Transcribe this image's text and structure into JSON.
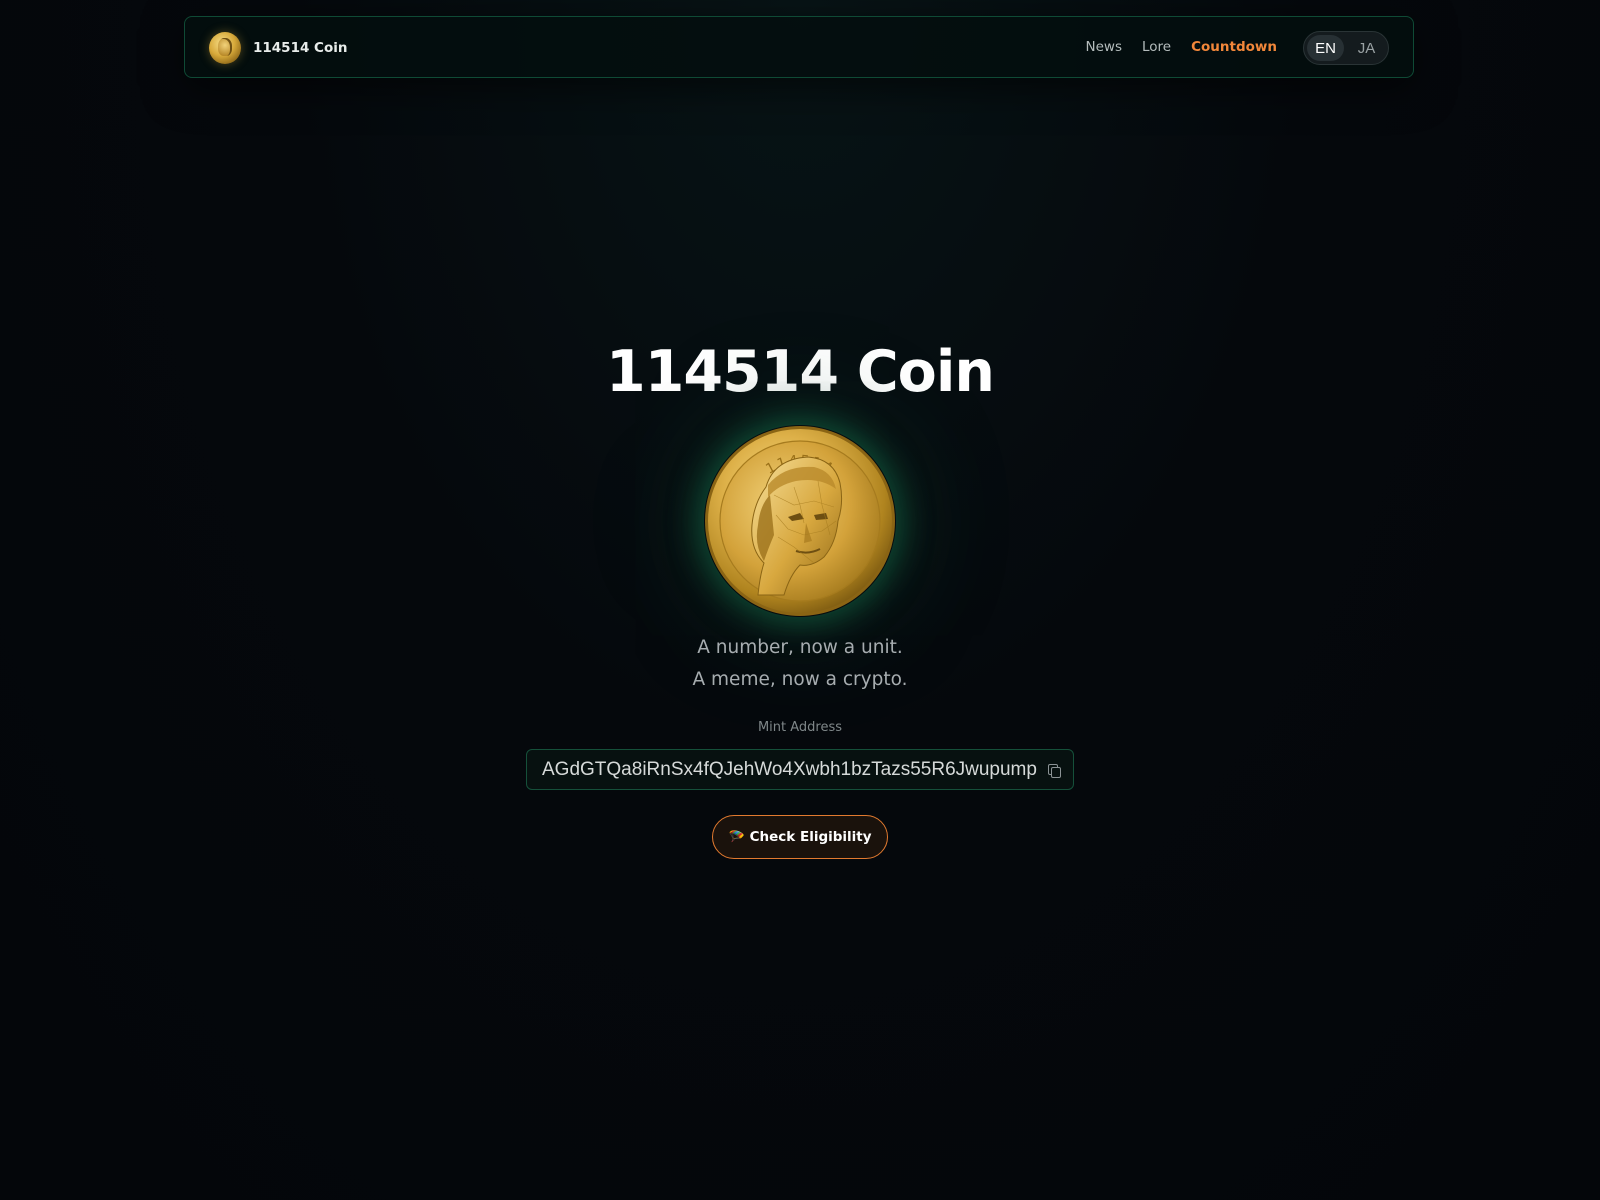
{
  "header": {
    "brand_name": "114514 Coin",
    "nav": {
      "news": "News",
      "lore": "Lore",
      "countdown": "Countdown"
    },
    "active_nav": "Countdown",
    "language": {
      "en": "EN",
      "ja": "JA",
      "selected": "EN"
    }
  },
  "hero": {
    "title": "114514 Coin",
    "coin_inscription": "114514",
    "tagline_line1": "A number, now a unit.",
    "tagline_line2": "A meme, now a crypto.",
    "mint_label": "Mint Address",
    "mint_address": "AGdGTQa8iRnSx4fQJehWo4Xwbh1bzTazs55R6Jwupump",
    "cta_icon": "🪂",
    "cta_label": "Check Eligibility"
  },
  "icons": {
    "copy": "copy-icon",
    "airdrop": "parachute-icon"
  },
  "colors": {
    "background": "#05080c",
    "accent_orange": "#f2873a",
    "border_green": "#15503a",
    "coin_gold": "#d7a93a"
  }
}
